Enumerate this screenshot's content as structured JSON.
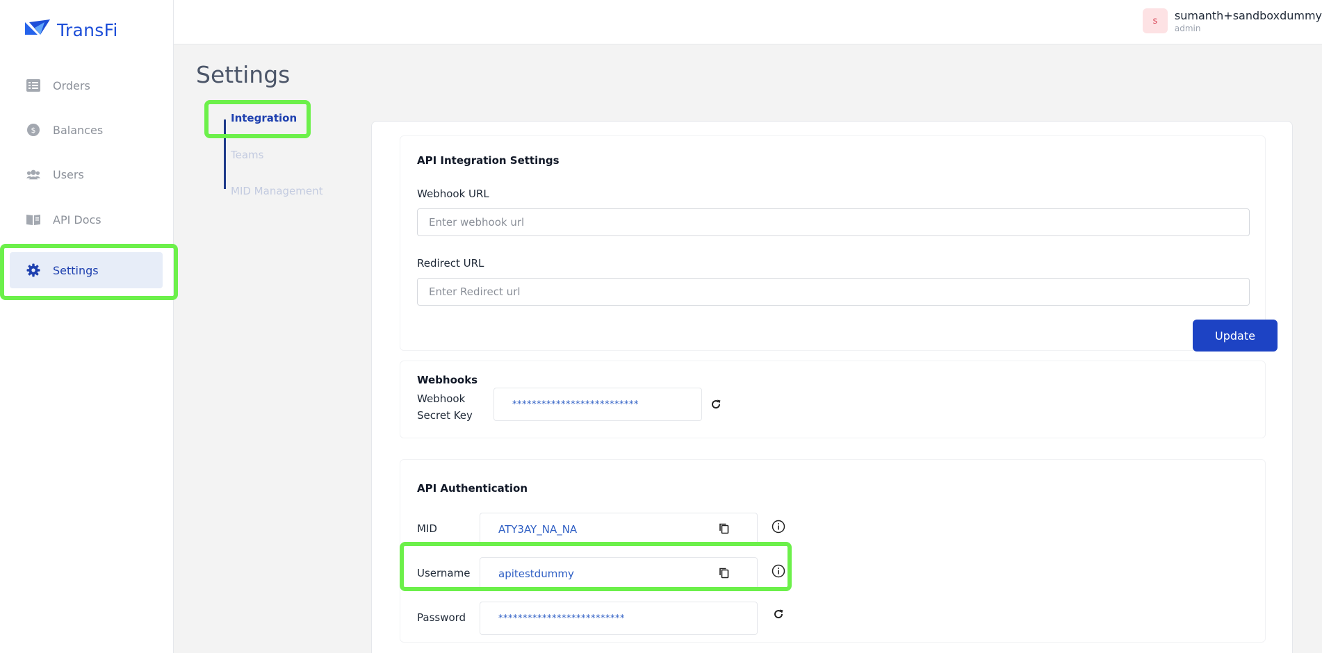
{
  "brand": {
    "name": "TransFi",
    "logo_icon": "transfi-logo",
    "accent": "#1d4ed8"
  },
  "sidebar": {
    "items": [
      {
        "label": "Orders",
        "icon": "list-icon",
        "active": false
      },
      {
        "label": "Balances",
        "icon": "coin-icon",
        "active": false
      },
      {
        "label": "Users",
        "icon": "users-icon",
        "active": false
      },
      {
        "label": "API Docs",
        "icon": "book-icon",
        "active": false
      },
      {
        "label": "Settings",
        "icon": "gear-icon",
        "active": true
      }
    ]
  },
  "header": {
    "avatar_initial": "s",
    "user_name": "sumanth+sandboxdummy",
    "user_role": "admin"
  },
  "page": {
    "title": "Settings"
  },
  "subtabs": [
    {
      "label": "Integration",
      "active": true
    },
    {
      "label": "Teams",
      "active": false
    },
    {
      "label": "MID Management",
      "active": false
    }
  ],
  "integration": {
    "title": "API Integration Settings",
    "webhook_url_label": "Webhook URL",
    "webhook_url_placeholder": "Enter webhook url",
    "webhook_url_value": "",
    "redirect_url_label": "Redirect URL",
    "redirect_url_placeholder": "Enter Redirect url",
    "redirect_url_value": "",
    "update_label": "Update"
  },
  "webhooks": {
    "title": "Webhooks",
    "secret_label_line1": "Webhook",
    "secret_label_line2": "Secret Key",
    "secret_value": "**************************"
  },
  "auth": {
    "title": "API Authentication",
    "mid_label": "MID",
    "mid_value": "ATY3AY_NA_NA",
    "username_label": "Username",
    "username_value": "apitestdummy",
    "password_label": "Password",
    "password_value": "**************************"
  },
  "colors": {
    "highlight": "#6cf04a",
    "primary_button": "#1d43c4",
    "value_text": "#2f5fc4"
  }
}
